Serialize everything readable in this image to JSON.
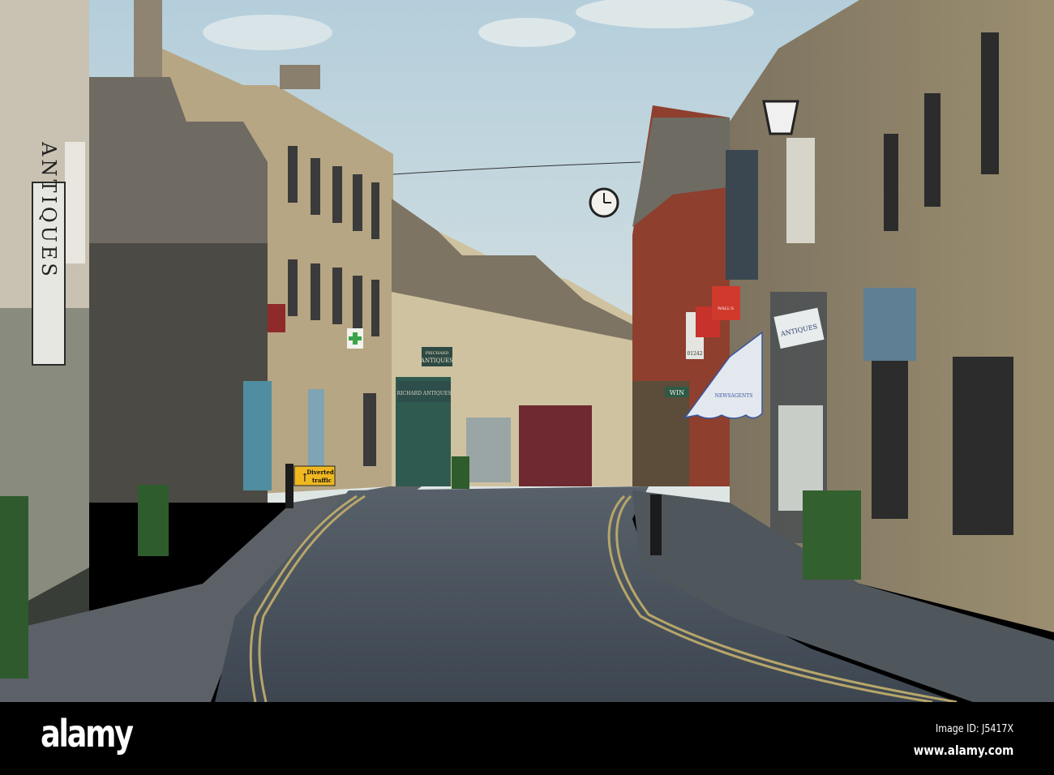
{
  "scene": {
    "signs": {
      "left_vertical": "ANTIQUES",
      "hanging_sign_top": "PRICHARD",
      "hanging_sign_bottom": "ANTIQUES",
      "shopfront": "RICHARD ANTIQUES",
      "diversion_line1": "Diverted",
      "diversion_line2": "traffic",
      "green_sign": "WIN",
      "awning": "NEWSAGENTS",
      "right_shop_sign": "ANTIQUES",
      "flag_brand": "WALL'S",
      "phone_sign": "01242"
    },
    "colors": {
      "sky": "#c6d9e3",
      "stone": "#a8987a",
      "brick": "#8e3f2e",
      "road": "#46505a"
    }
  },
  "footer": {
    "logo": "alamy",
    "image_id": "Image ID: J5417X",
    "url": "www.alamy.com"
  }
}
